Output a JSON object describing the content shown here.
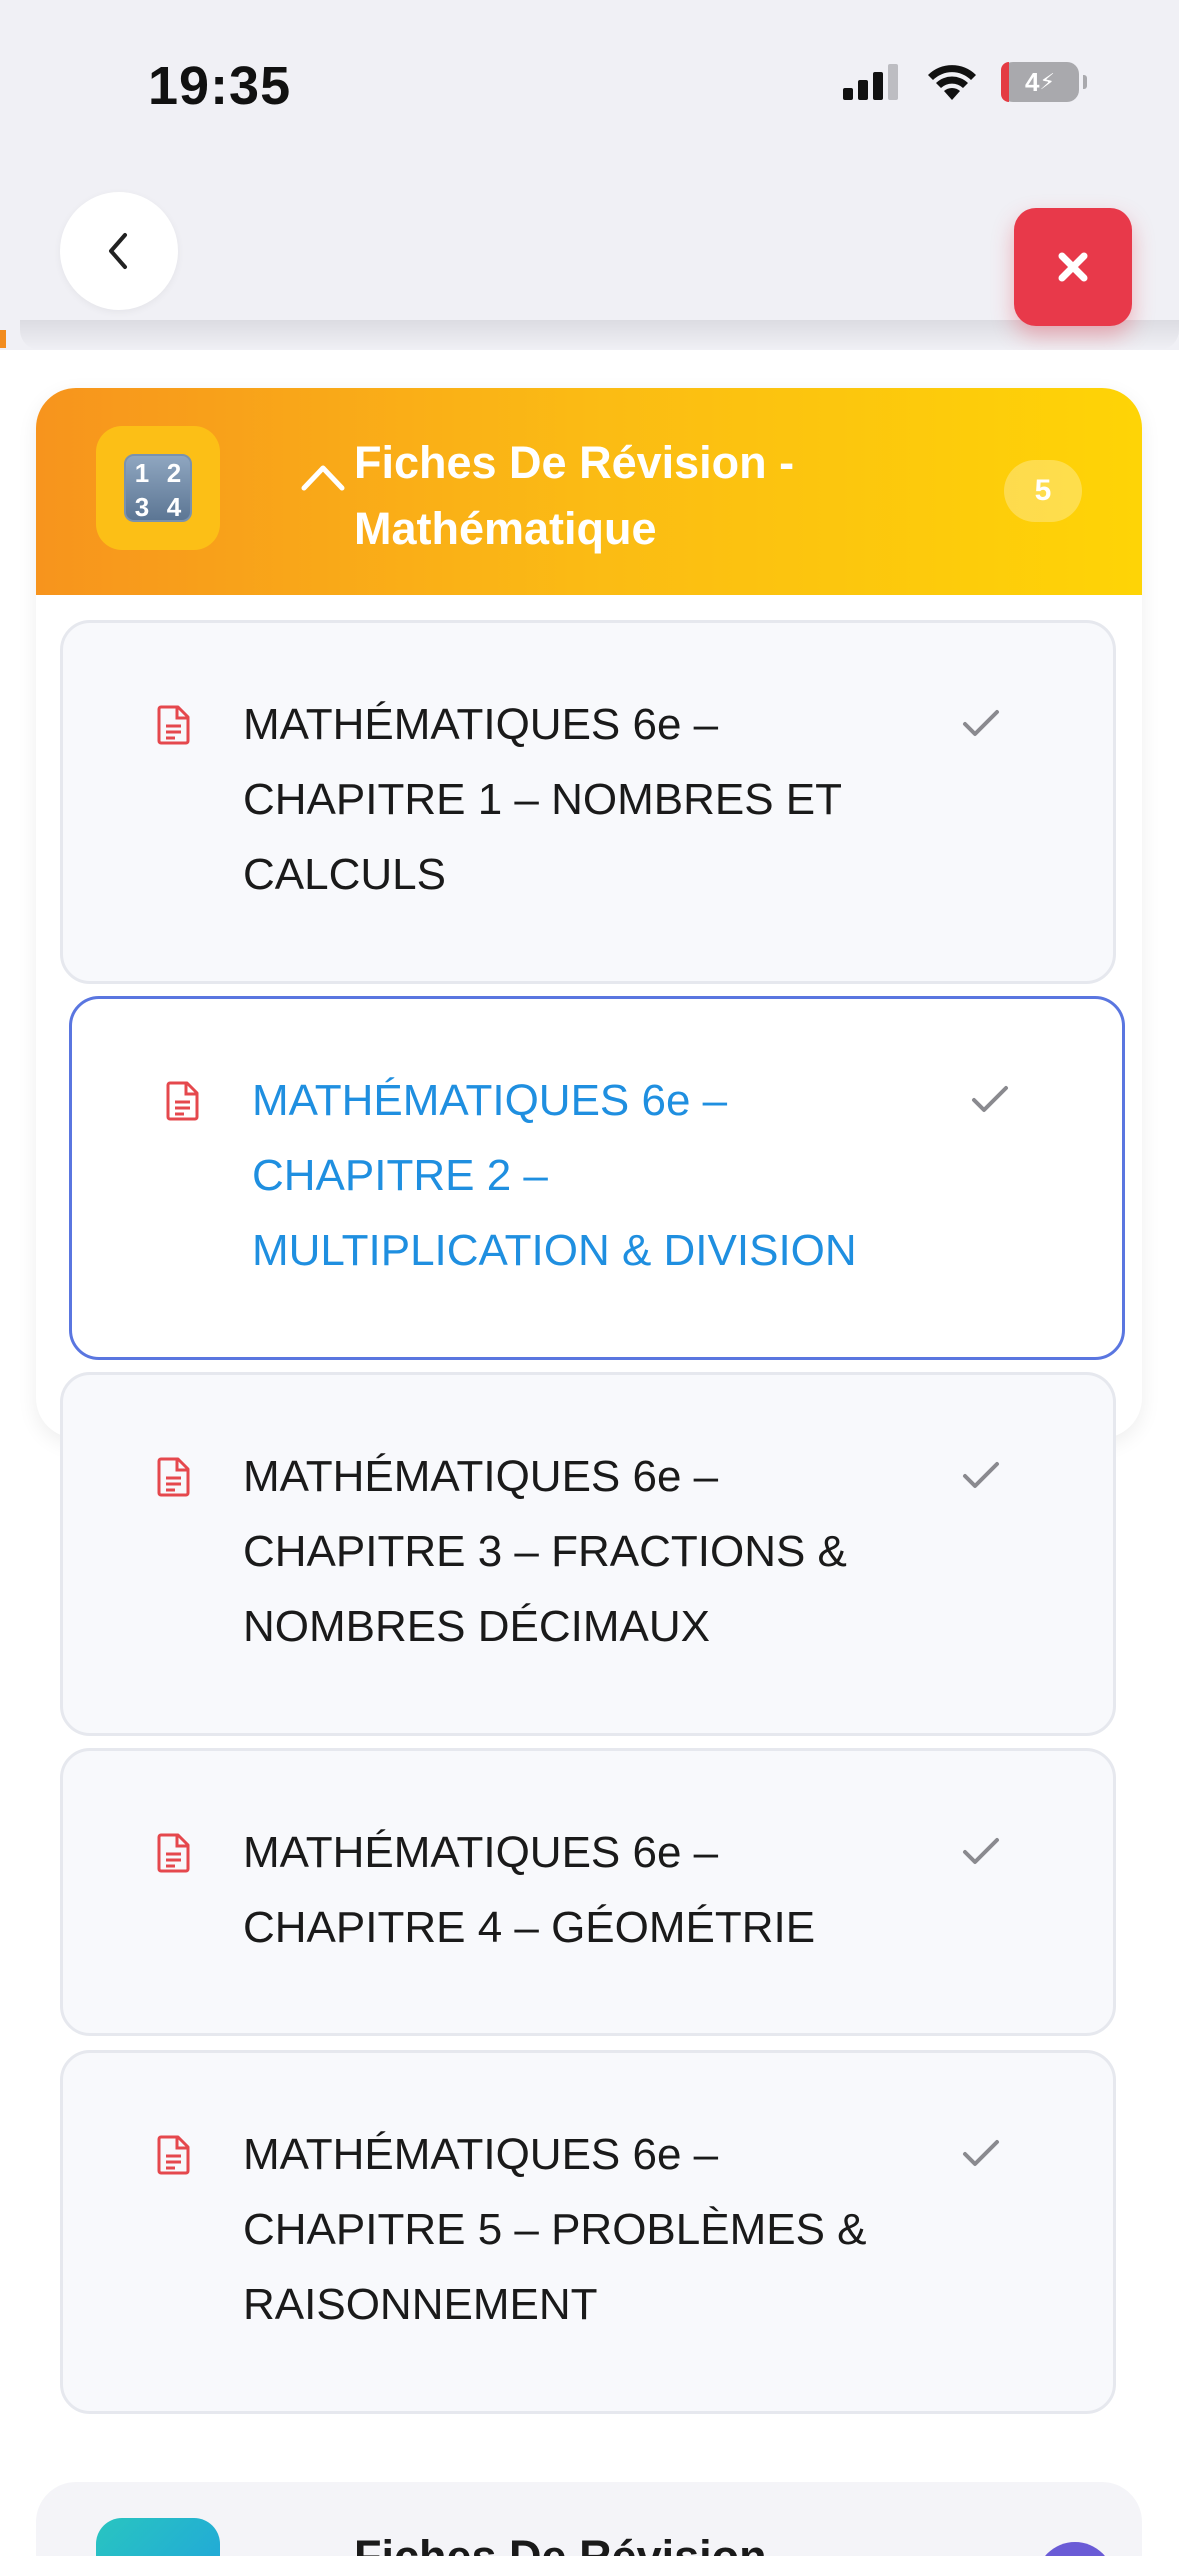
{
  "status_bar": {
    "time": "19:35",
    "battery": "4"
  },
  "header": {
    "back_icon": "chevron-left-icon",
    "close_icon": "close-x-icon",
    "close_color": "#e8394a"
  },
  "section": {
    "icon": "input-numbers-icon",
    "icon_glyphs": [
      "1",
      "2",
      "3",
      "4"
    ],
    "title": "Fiches De Révision - Mathématique",
    "count": "5",
    "expanded": true,
    "gradient": [
      "#f7941d",
      "#fed406"
    ]
  },
  "lessons": [
    {
      "title": "MATHÉMATIQUES 6e – CHAPITRE 1 – NOMBRES ET CALCULS",
      "active": false
    },
    {
      "title": "MATHÉMATIQUES 6e – CHAPITRE 2 – MULTIPLICATION & DIVISION",
      "active": true
    },
    {
      "title": "MATHÉMATIQUES 6e – CHAPITRE 3 – FRACTIONS & NOMBRES DÉCIMAUX",
      "active": false
    },
    {
      "title": "MATHÉMATIQUES 6e – CHAPITRE 4 – GÉOMÉTRIE",
      "active": false
    },
    {
      "title": "MATHÉMATIQUES 6e – CHAPITRE 5 – PROBLÈMES & RAISONNEMENT",
      "active": false
    }
  ],
  "next_section": {
    "title": "Fiches De Révision -"
  },
  "colors": {
    "active_text": "#1f8fe0",
    "active_border": "#5a76e0",
    "doc_icon": "#e5484d"
  }
}
